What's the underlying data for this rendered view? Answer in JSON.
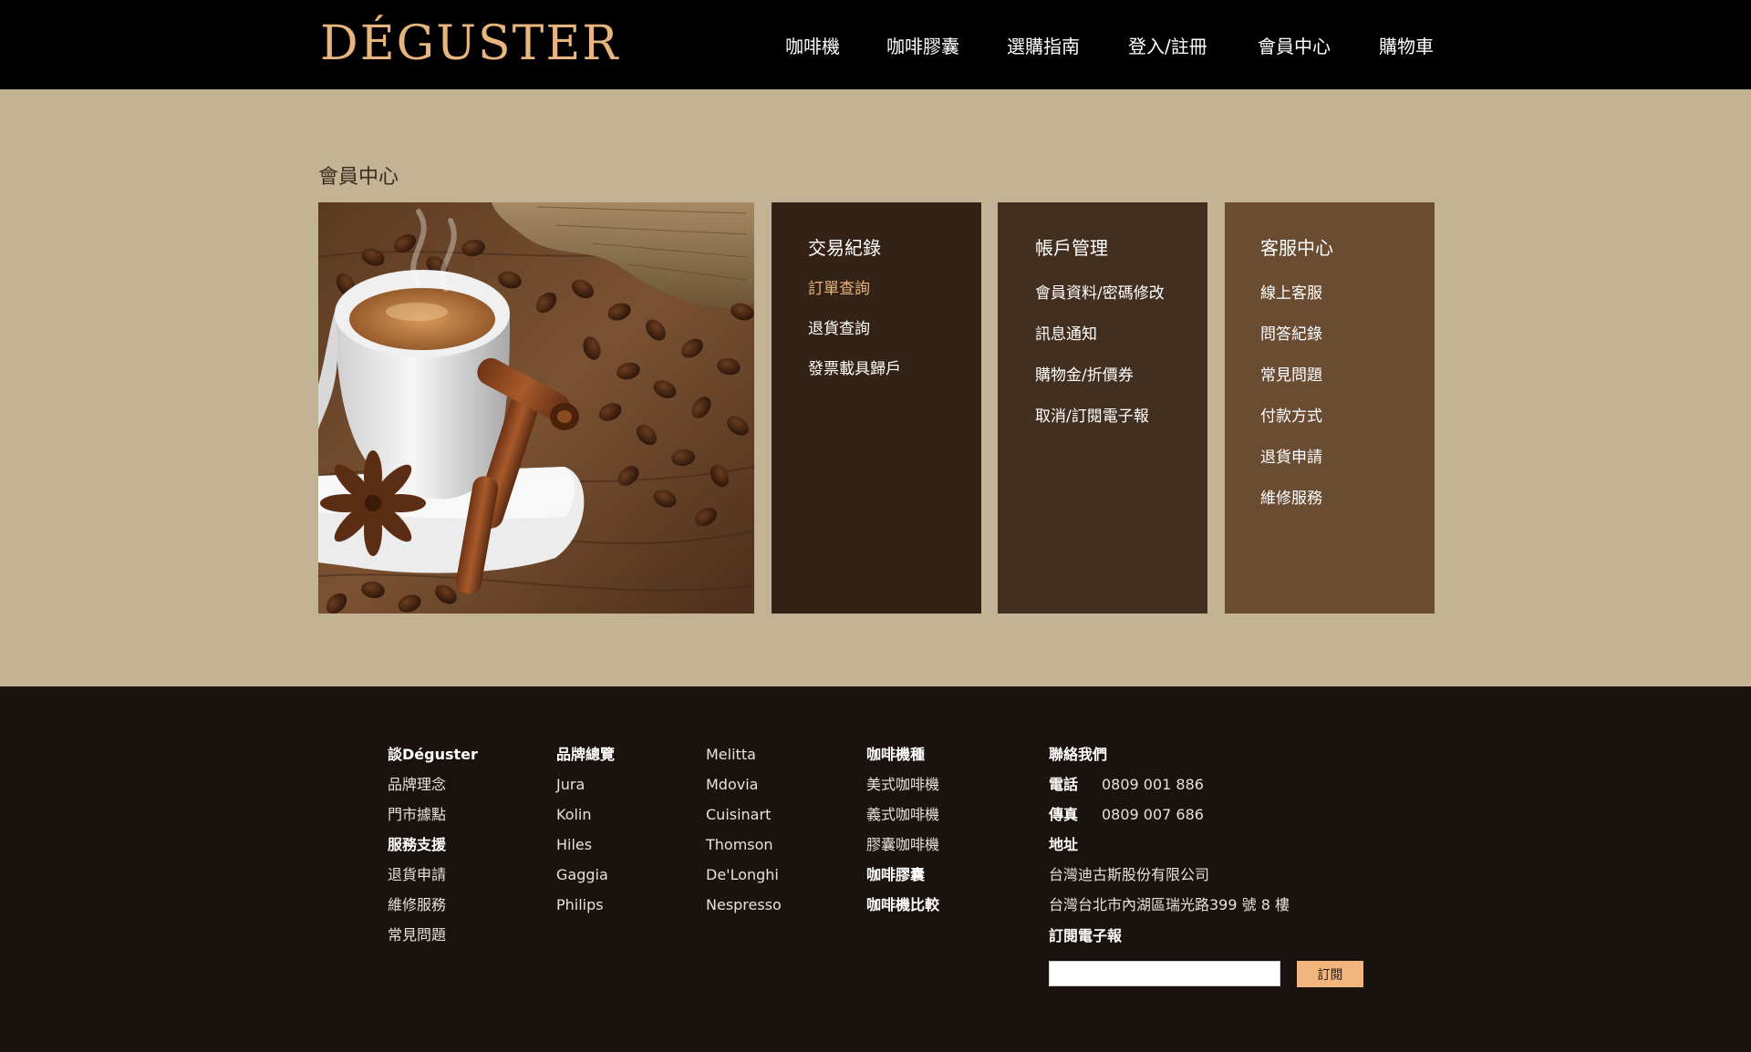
{
  "header": {
    "logo": "DÉGUSTER",
    "nav": [
      "咖啡機",
      "咖啡膠囊",
      "選購指南",
      "登入/註冊",
      "會員中心",
      "購物車"
    ]
  },
  "main": {
    "title": "會員中心",
    "panels": [
      {
        "title": "交易紀錄",
        "links": [
          "訂單查詢",
          "退貨查詢",
          "發票載具歸戶"
        ],
        "active_index": 0
      },
      {
        "title": "帳戶管理",
        "links": [
          "會員資料/密碼修改",
          "訊息通知",
          "購物金/折價券",
          "取消/訂閱電子報"
        ]
      },
      {
        "title": "客服中心",
        "links": [
          "線上客服",
          "問答紀錄",
          "常見問題",
          "付款方式",
          "退貨申請",
          "維修服務"
        ]
      }
    ]
  },
  "footer": {
    "col1": [
      "談Déguster",
      "品牌理念",
      "門市據點",
      "服務支援",
      "退貨申請",
      "維修服務",
      "常見問題"
    ],
    "col2": [
      "品牌總覽",
      "Jura",
      "Kolin",
      "Hiles",
      "Gaggia",
      "Philips"
    ],
    "col3": [
      "Melitta",
      "Mdovia",
      "Cuisinart",
      "Thomson",
      "De'Longhi",
      "Nespresso"
    ],
    "col4": [
      "咖啡機種",
      "美式咖啡機",
      "義式咖啡機",
      "膠囊咖啡機",
      "咖啡膠囊",
      "咖啡機比較"
    ],
    "contact": {
      "title": "聯絡我們",
      "phone_label": "電話",
      "phone": "0809 001 886",
      "fax_label": "傳真",
      "fax": "0809 007 686",
      "address_label": "地址",
      "company": "台灣迪古斯股份有限公司",
      "address": "台灣台北市內湖區瑞光路399 號 8 樓",
      "newsletter_label": "訂閱電子報",
      "subscribe_button": "訂閱"
    }
  },
  "colors": {
    "accent": "#e8b57e",
    "page_bg": "#c3b294",
    "header_bg": "#000000",
    "footer_bg": "#1a120e",
    "panel_1": "#342216",
    "panel_2": "#432f1f",
    "panel_3": "#6a4c32"
  }
}
